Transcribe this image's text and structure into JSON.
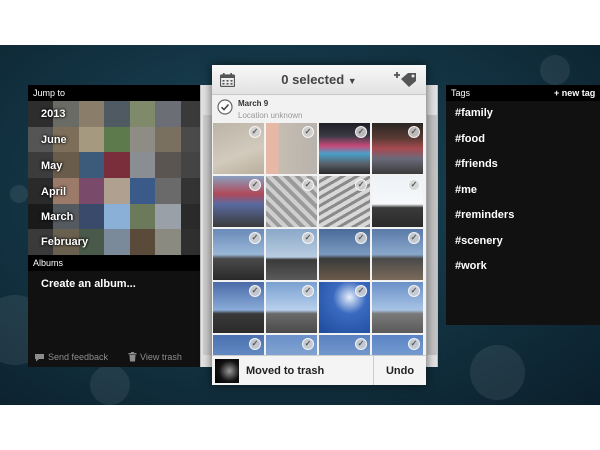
{
  "left": {
    "jump_header": "Jump to",
    "jump_items": [
      "2013",
      "June",
      "May",
      "April",
      "March",
      "February"
    ],
    "albums_header": "Albums",
    "create_album": "Create an album...",
    "footer": {
      "feedback": "Send feedback",
      "trash": "View trash"
    }
  },
  "center": {
    "selected_label": "0 selected",
    "date": "March 9",
    "location": "Location unknown",
    "toast_text": "Moved to trash",
    "undo_label": "Undo"
  },
  "right": {
    "tags_header": "Tags",
    "new_tag": "+ new tag",
    "tags": [
      "#family",
      "#food",
      "#friends",
      "#me",
      "#reminders",
      "#scenery",
      "#work"
    ]
  },
  "colors": {
    "background": "#143646",
    "panel_dark": "#111111",
    "center_panel": "#f2f2f2"
  },
  "icons": [
    "calendar-icon",
    "add-tag-icon",
    "check-icon",
    "feedback-icon",
    "trash-icon"
  ]
}
